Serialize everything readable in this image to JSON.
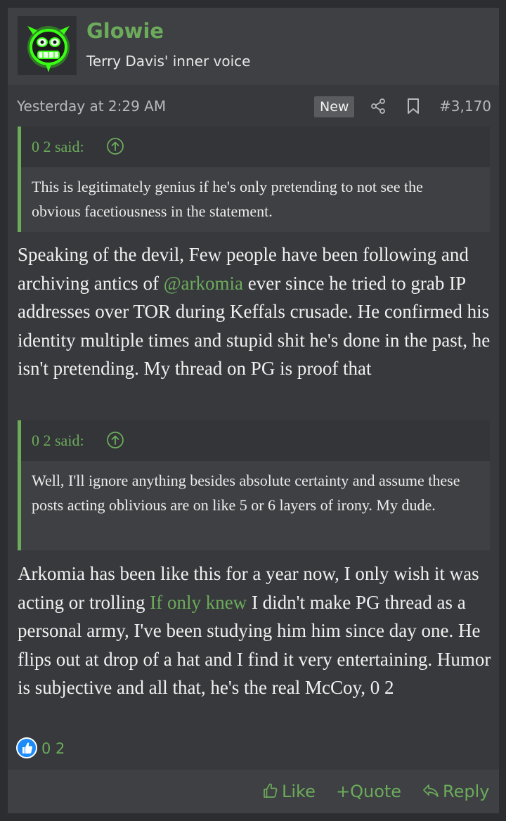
{
  "user": {
    "name": "Glowie",
    "title": "Terry Davis' inner voice",
    "avatar_icon": "green-glowing-cartoon-face-icon"
  },
  "meta": {
    "date": "Yesterday at 2:29 AM",
    "badge": "New",
    "share_icon": "share-icon",
    "bookmark_icon": "bookmark-icon",
    "post_number": "#3,170"
  },
  "quote1": {
    "author": "0 2 said:",
    "text": "This is legitimately genius if he's only pretending to not see the obvious facetiousness in the statement."
  },
  "paragraph1": {
    "before": "Speaking of the devil, Few people have been following and archiving antics of ",
    "mention": "@arkomia",
    "after": " ever since he tried to grab IP addresses over TOR during Keffals crusade. He confirmed his identity multiple times and stupid shit he's done in the past, he isn't pretending. My thread on PG is proof that"
  },
  "quote2": {
    "author": "0 2 said:",
    "text": "Well, I'll ignore anything besides absolute certainty and assume these posts acting oblivious are on like 5 or 6 layers of irony. My dude."
  },
  "paragraph2": {
    "before": "Arkomia has been like this for a year now, I only wish it was acting or trolling ",
    "link": "If only knew",
    "after": " I didn't make PG thread as a personal army, I've been studying him him since day one. He flips out at drop of a hat and I find it very entertaining. Humor is subjective and all that, he's the real McCoy, 0 2"
  },
  "reactions": {
    "icon": "thumbs-up-icon",
    "users": "0 2"
  },
  "actions": {
    "like": "Like",
    "quote": "Quote",
    "reply": "Reply"
  },
  "colors": {
    "accent": "#6cab5b",
    "background": "#2b2d30",
    "post": "#37393c",
    "header": "#3e4043",
    "like_badge": "#1d8cf8"
  }
}
